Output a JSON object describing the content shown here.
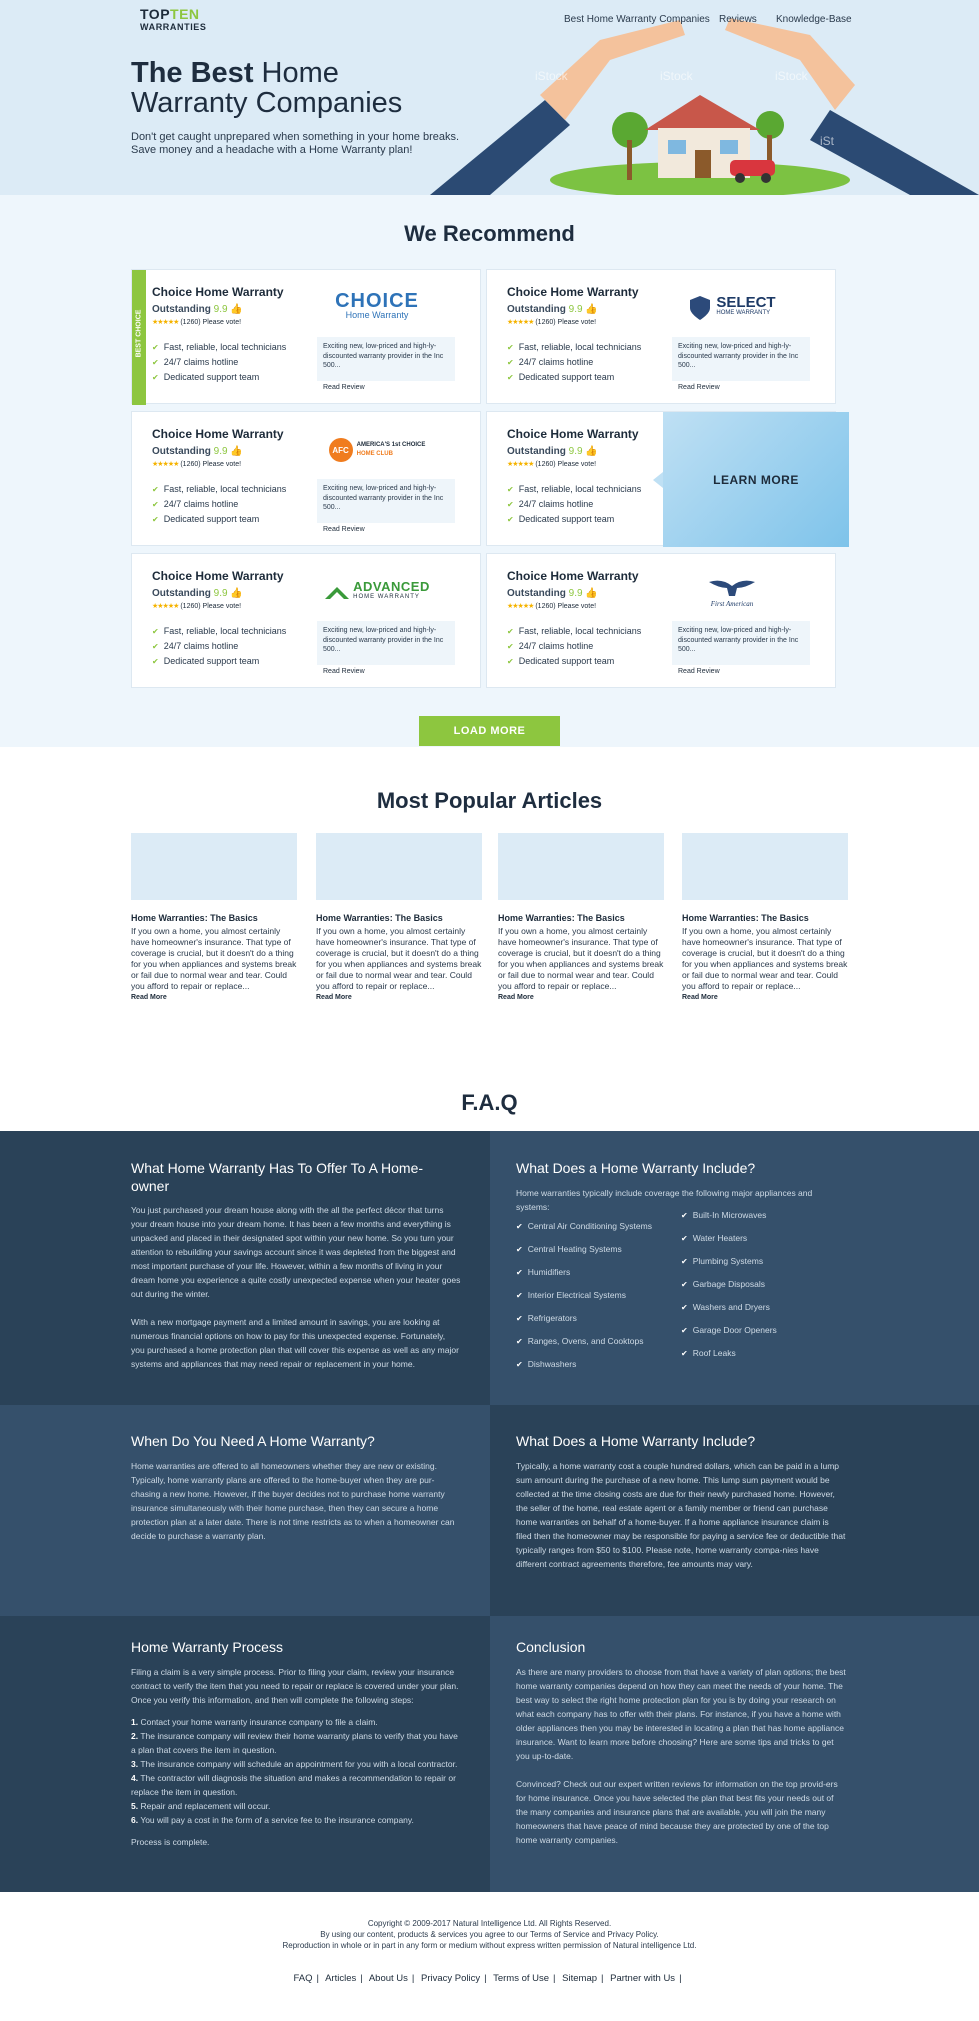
{
  "header": {
    "logo_top": "TOP",
    "logo_top2": "TEN",
    "logo_bottom": "WARRANTIES",
    "nav": [
      "Best Home Warranty Companies",
      "Reviews",
      "Knowledge-Base"
    ]
  },
  "hero": {
    "title_bold": "The Best",
    "title_rest": " Home",
    "title_line2": "Warranty Companies",
    "subtitle": "Don't get caught unprepared when something in your home breaks. Save money and a headache with a Home Warranty plan!"
  },
  "recommend": {
    "title": "We Recommend",
    "best_tag": "BEST CHOICE",
    "cards": [
      {
        "name": "Choice Home Warranty",
        "rating_label": "Outstanding",
        "score": "9.9",
        "votes": "(1260) Please vote!",
        "features": [
          "Fast, reliable, local technicians",
          "24/7 claims hotline",
          "Dedicated support team"
        ],
        "blurb": "Exciting new, low-priced and high-ly-discounted warranty provider in the Inc 500...",
        "read": "Read Review",
        "brand": "CHOICE",
        "brand_sub": "Home Warranty"
      },
      {
        "name": "Choice Home Warranty",
        "rating_label": "Outstanding",
        "score": "9.9",
        "votes": "(1260) Please vote!",
        "features": [
          "Fast, reliable, local technicians",
          "24/7 claims hotline",
          "Dedicated support team"
        ],
        "blurb": "Exciting new, low-priced and high-ly-discounted warranty provider in the Inc 500...",
        "read": "Read Review",
        "brand": "SELECT",
        "brand_sub": "HOME WARRANTY"
      },
      {
        "name": "Choice Home Warranty",
        "rating_label": "Outstanding",
        "score": "9.9",
        "votes": "(1260) Please vote!",
        "features": [
          "Fast, reliable, local technicians",
          "24/7 claims hotline",
          "Dedicated support team"
        ],
        "blurb": "Exciting new, low-priced and high-ly-discounted warranty provider in the Inc 500...",
        "read": "Read Review",
        "brand": "AMERICA'S 1st CHOICE",
        "brand_sub": "HOME CLUB"
      },
      {
        "name": "Choice Home Warranty",
        "rating_label": "Outstanding",
        "score": "9.9",
        "votes": "(1260) Please vote!",
        "features": [
          "Fast, reliable, local technicians",
          "24/7 claims hotline",
          "Dedicated support team"
        ],
        "blurb": "Exciting new, low-priced and high-ly-discounted warranty provider in the Inc 500...",
        "read": "Read Review",
        "brand": "",
        "brand_sub": ""
      },
      {
        "name": "Choice Home Warranty",
        "rating_label": "Outstanding",
        "score": "9.9",
        "votes": "(1260) Please vote!",
        "features": [
          "Fast, reliable, local technicians",
          "24/7 claims hotline",
          "Dedicated support team"
        ],
        "blurb": "Exciting new, low-priced and high-ly-discounted warranty provider in the Inc 500...",
        "read": "Read Review",
        "brand": "ADVANCED",
        "brand_sub": "HOME WARRANTY"
      },
      {
        "name": "Choice Home Warranty",
        "rating_label": "Outstanding",
        "score": "9.9",
        "votes": "(1260) Please vote!",
        "features": [
          "Fast, reliable, local technicians",
          "24/7 claims hotline",
          "Dedicated support team"
        ],
        "blurb": "Exciting new, low-priced and high-ly-discounted warranty provider in the Inc 500...",
        "read": "Read Review",
        "brand": "First American",
        "brand_sub": ""
      }
    ],
    "learn_more": "LEARN MORE",
    "load_more": "LOAD MORE"
  },
  "articles": {
    "title": "Most Popular Articles",
    "items": [
      {
        "title": "Home Warranties: The Basics",
        "body": "If you own a home, you almost certainly have homeowner's insurance. That type of coverage is crucial, but it doesn't do a thing for you when appliances and systems break or fail due to normal wear and tear. Could you afford to repair or replace...",
        "read": "Read More"
      },
      {
        "title": "Home Warranties: The Basics",
        "body": "If you own a home, you almost certainly have homeowner's insurance. That type of coverage is crucial, but it doesn't do a thing for you when appliances and systems break or fail due to normal wear and tear. Could you afford to repair or replace...",
        "read": "Read More"
      },
      {
        "title": "Home Warranties: The Basics",
        "body": "If you own a home, you almost certainly have homeowner's insurance. That type of coverage is crucial, but it doesn't do a thing for you when appliances and systems break or fail due to normal wear and tear. Could you afford to repair or replace...",
        "read": "Read More"
      },
      {
        "title": "Home Warranties: The Basics",
        "body": "If you own a home, you almost certainly have homeowner's insurance. That type of coverage is crucial, but it doesn't do a thing for you when appliances and systems break or fail due to normal wear and tear. Could you afford to repair or replace...",
        "read": "Read More"
      }
    ]
  },
  "faq": {
    "title": "F.A.Q",
    "colors": {
      "dark": "#2a4258",
      "mid": "#35506b"
    },
    "q1": {
      "title": "What Home Warranty Has To Offer To A Home-owner",
      "p1": "You just purchased your dream house along with the all the perfect décor that turns your dream house into your dream home. It has been a few months and everything is unpacked and placed in their designated spot within your new home. So you turn your attention to rebuilding your savings account since it was depleted from the biggest and most important purchase of your life. However, within a few months of living in your dream home you experience a quite costly unexpected expense when your heater goes out during the winter.",
      "p2": "With a new mortgage payment and a limited amount in savings, you are looking at numerous financial options on how to pay for this unexpected expense. Fortunately, you purchased a home protection plan that will cover this expense as well as any major systems and appliances that may need repair or replacement in your home."
    },
    "q2": {
      "title": "What Does a Home Warranty Include?",
      "intro": "Home warranties typically include coverage the following major appliances and systems:",
      "left": [
        "Central Air Conditioning Systems",
        "Central Heating Systems",
        "Humidifiers",
        "Interior Electrical Systems",
        "Refrigerators",
        "Ranges, Ovens, and Cooktops",
        "Dishwashers"
      ],
      "right": [
        "Built-In Microwaves",
        "Water Heaters",
        "Plumbing Systems",
        "Garbage Disposals",
        "Washers and Dryers",
        "Garage Door Openers",
        "Roof Leaks"
      ]
    },
    "q3": {
      "title": "When Do You Need A Home Warranty?",
      "p1": "Home warranties are offered to all homeowners whether they are new or existing. Typically, home warranty plans are offered to the home-buyer when they are pur-chasing a new home. However, if the buyer decides not to purchase home warranty insurance simultaneously with their home purchase, then they can secure a home protection plan at a later date. There is not time restricts as to when a homeowner can decide to purchase a warranty plan."
    },
    "q4": {
      "title": "What Does a Home Warranty Include?",
      "p1": "Typically, a home warranty cost a couple hundred dollars, which can be paid in a lump sum amount during the purchase of a new home. This lump sum payment would be collected at the time closing costs are due for their newly purchased home. However, the seller of the home, real estate agent or a family member or friend can purchase home warranties on behalf of a home-buyer. If a home appliance insurance claim is filed then the homeowner may be responsible for paying a service fee or deductible that typically ranges from $50 to $100. Please note, home warranty compa-nies have different contract agreements therefore, fee amounts may vary."
    },
    "q5": {
      "title": "Home Warranty Process",
      "intro": "Filing a claim is a very simple process. Prior to filing your claim, review your insurance contract to verify the item that you need to repair or replace is covered under your plan. Once you verify this information, and then will complete the following steps:",
      "steps": [
        {
          "n": "1.",
          "t": "Contact your home warranty insurance company to file a claim."
        },
        {
          "n": "2.",
          "t": "The insurance company will review their home warranty plans to verify that you have a plan that covers the item in question."
        },
        {
          "n": "3.",
          "t": "The insurance company will schedule an appointment for you with a local contractor."
        },
        {
          "n": "4.",
          "t": "The contractor will diagnosis the situation and makes a recommendation to repair or replace the item in question."
        },
        {
          "n": "5.",
          "t": "Repair and replacement will occur."
        },
        {
          "n": "6.",
          "t": "You will pay a cost in the form of a service fee to the insurance company."
        }
      ],
      "outro": "Process is complete."
    },
    "q6": {
      "title": "Conclusion",
      "p1": "As there are many providers to choose from that have a variety of plan options; the best home warranty companies depend on how they can meet the needs of your home. The best way to select the right home protection plan for you is by doing your research on what each company has to offer with their plans. For instance, if you have a home with older appliances then you may be interested in locating a plan that has home appliance insurance. Want to learn more before choosing? Here are some tips and tricks to get you up-to-date.",
      "p2": "Convinced? Check out our expert written reviews for information on the top provid-ers for home insurance. Once you have selected the plan that best fits your needs out of the many companies and insurance plans that are available, you will join the many homeowners that have peace of mind because they are protected by one of the top home warranty companies."
    }
  },
  "footer": {
    "line1": "Copyright © 2009-2017 Natural Intelligence Ltd. All Rights Reserved.",
    "line2": "By using our content, products & services you agree to our Terms of Service and Privacy Policy.",
    "line3": "Reproduction in whole or in part in any form or medium without express written permission of Natural intelligence Ltd.",
    "links": [
      "FAQ",
      "Articles",
      "About Us",
      "Privacy Policy",
      "Terms of Use",
      "Sitemap",
      "Partner with Us"
    ]
  }
}
